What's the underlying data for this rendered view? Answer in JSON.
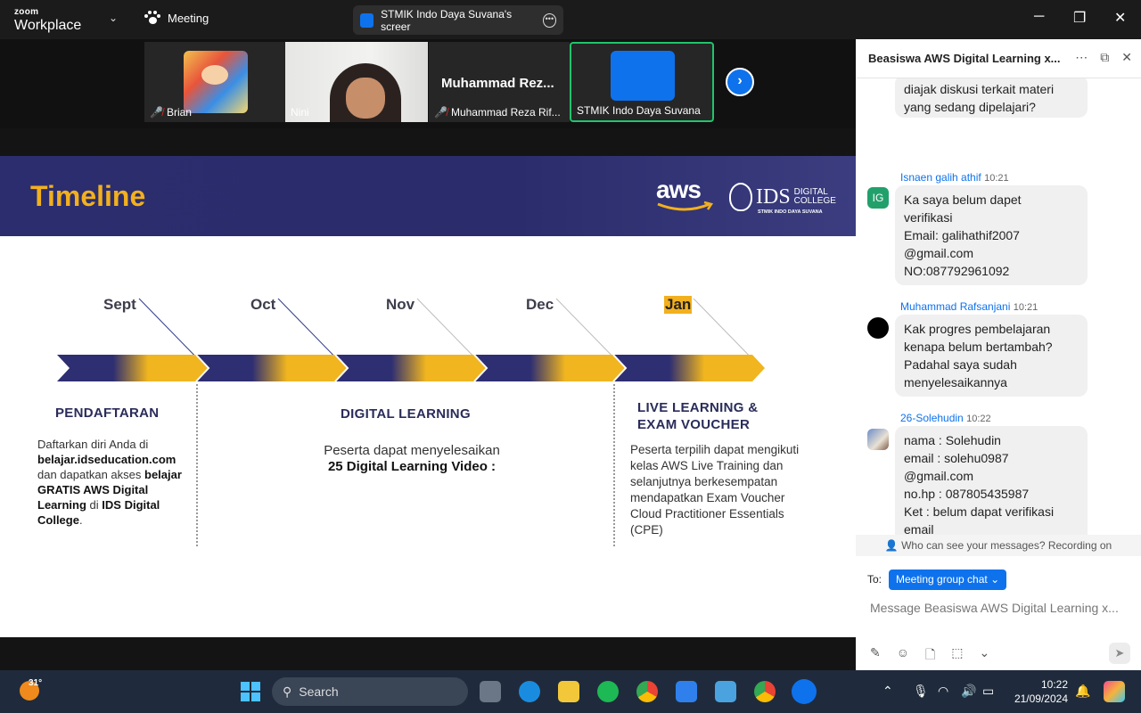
{
  "titlebar": {
    "brand_small": "zoom",
    "brand_big": "Workplace",
    "meeting_label": "Meeting",
    "share_label": "STMIK Indo Daya Suvana's screer",
    "minimize": "─",
    "restore": "❐",
    "close": "✕"
  },
  "video_strip": {
    "tiles": [
      {
        "name": "Brian",
        "muted": true
      },
      {
        "name": "Nini",
        "muted": false
      },
      {
        "name": "Muhammad Reza Rif...",
        "display": "Muhammad  Rez...",
        "muted": true
      },
      {
        "name": "STMIK Indo Daya Suvana",
        "muted": false,
        "active": true
      }
    ],
    "next": "›"
  },
  "slide": {
    "title": "Timeline",
    "aws": "aws",
    "ids_main": "IDS",
    "ids_sub1": "DIGITAL",
    "ids_sub2": "COLLEGE",
    "ids_tagline": "STMIK INDO DAYA SUVANA",
    "months": [
      "Sept",
      "Oct",
      "Nov",
      "Dec",
      "Jan"
    ],
    "sections": [
      {
        "title": "PENDAFTARAN",
        "t1": "Daftarkan diri Anda di",
        "b1": "belajar.idseducation.com",
        "t2": "dan dapatkan akses",
        "b2": "belajar GRATIS AWS Digital Learning",
        "t3": "di",
        "b3": "IDS Digital College",
        "t4": "."
      },
      {
        "title": "DIGITAL LEARNING",
        "line1": "Peserta dapat menyelesaikan",
        "line2": "25 Digital Learning Video :"
      },
      {
        "title_1": "LIVE LEARNING &",
        "title_2": "EXAM VOUCHER",
        "text": "Peserta terpilih dapat mengikuti kelas AWS Live Training dan selanjutnya berkesempatan mendapatkan Exam Voucher Cloud Practitioner Essentials (CPE)"
      }
    ]
  },
  "chat": {
    "title": "Beasiswa AWS Digital Learning x...",
    "messages": [
      {
        "text": "diajak diskusi terkait materi\nyang sedang dipelajari?"
      },
      {
        "sender": "Isnaen galih athif",
        "time": "10:21",
        "initials": "IG",
        "text": "Ka saya belum dapet\nverifikasi\nEmail: galihathif2007\n@gmail.com\nNO:087792961092"
      },
      {
        "sender": "Muhammad Rafsanjani",
        "time": "10:21",
        "text": "Kak progres pembelajaran\nkenapa belum bertambah?\nPadahal saya sudah\nmenyelesaikannya"
      },
      {
        "sender": "26-Solehudin",
        "time": "10:22",
        "text": "nama : Solehudin\nemail : solehu0987\n@gmail.com\nno.hp : 087805435987\nKet : belum dapat verifikasi\nemail"
      }
    ],
    "notice": "Who can see your messages? Recording on",
    "to_label": "To:",
    "to_target": "Meeting group chat",
    "input_placeholder": "Message Beasiswa AWS Digital Learning x..."
  },
  "taskbar": {
    "temperature": "31°",
    "search_label": "Search",
    "time": "10:22",
    "date": "21/09/2024"
  },
  "colors": {
    "zoom_blue": "#0e72ed",
    "slide_navy": "#2b2d6e",
    "slide_gold": "#f2b01e",
    "active_green": "#21c46b"
  }
}
